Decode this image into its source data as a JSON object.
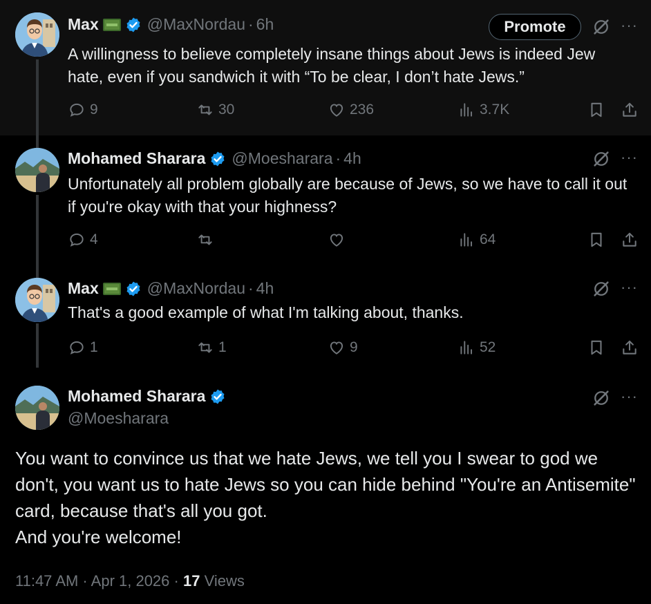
{
  "tweets": [
    {
      "name": "Max",
      "handle": "@MaxNordau",
      "sep": "·",
      "time": "6h",
      "text": "A willingness to believe completely insane things about Jews is indeed Jew hate, even if you sandwich it with “To be clear, I don’t hate Jews.”",
      "replies": "9",
      "retweets": "30",
      "likes": "236",
      "views": "3.7K",
      "promote_label": "Promote"
    },
    {
      "name": "Mohamed Sharara",
      "handle": "@Moesharara",
      "sep": "·",
      "time": "4h",
      "text": "Unfortunately all problem globally are because of Jews, so we have to call it out if you're okay with that your highness?",
      "replies": "4",
      "retweets": "",
      "likes": "",
      "views": "64"
    },
    {
      "name": "Max",
      "handle": "@MaxNordau",
      "sep": "·",
      "time": "4h",
      "text": "That's a good example of what I'm talking about, thanks.",
      "replies": "1",
      "retweets": "1",
      "likes": "9",
      "views": "52"
    }
  ],
  "main": {
    "name": "Mohamed Sharara",
    "handle": "@Moesharara",
    "line1": "You want to convince us that we hate Jews, we tell you I swear to god we don't, you want us to hate Jews so you can hide behind \"You're an Antisemite\" card, because that's all you got.",
    "line2": "And you're welcome!",
    "timestamp": "11:47 AM · Apr 1, 2026 · ",
    "views_count": "17",
    "views_label": " Views"
  },
  "colors": {
    "background": "#000000",
    "text": "#e7e9ea",
    "muted": "#71767b",
    "verified": "#1d9bf0"
  },
  "icons": [
    "reply-icon",
    "retweet-icon",
    "like-icon",
    "views-icon",
    "bookmark-icon",
    "share-icon",
    "grok-icon",
    "more-icon",
    "verified-icon"
  ]
}
